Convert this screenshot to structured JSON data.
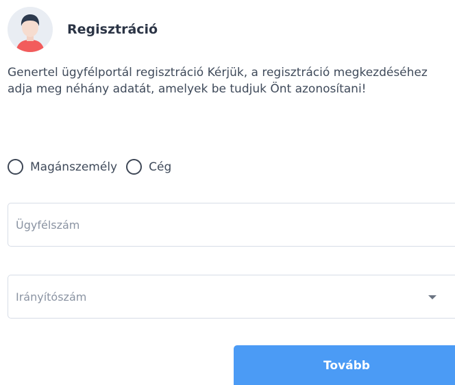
{
  "header": {
    "title": "Regisztráció",
    "avatar_icon": "user-avatar-icon"
  },
  "intro": {
    "text": "Genertel ügyfélportál regisztráció Kérjük, a regisztráció megkezdéséhez adja meg néhány adatát, amelyek be tudjuk Önt azonosítani!"
  },
  "customer_type": {
    "options": [
      {
        "label": "Magánszemély",
        "selected": false
      },
      {
        "label": "Cég",
        "selected": false
      }
    ]
  },
  "fields": {
    "customer_number": {
      "placeholder": "Ügyfélszám",
      "value": ""
    },
    "postal_code": {
      "placeholder": "Irányítószám",
      "value": ""
    }
  },
  "actions": {
    "next_label": "Tovább"
  },
  "colors": {
    "primary": "#4b9bf5",
    "border": "#d6dce6",
    "text": "#3f4a5a",
    "placeholder": "#8a93a2"
  }
}
